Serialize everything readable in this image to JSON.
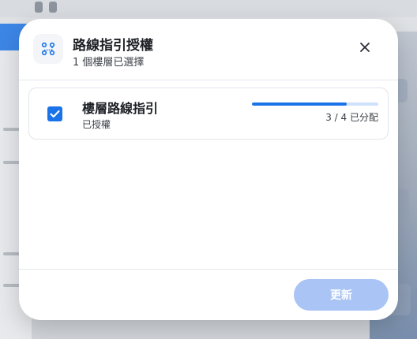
{
  "modal": {
    "title": "路線指引授權",
    "subtitle": "1 個樓層已選擇",
    "icon": "route-icon",
    "close_icon": "close-icon"
  },
  "floor_item": {
    "checked": true,
    "name": "樓層路線指引",
    "status": "已授權",
    "progress_fraction": 0.75,
    "progress_text": "3 / 4 已分配"
  },
  "footer": {
    "update_label": "更新",
    "update_enabled": false
  },
  "colors": {
    "accent": "#1a73e8",
    "accent_light": "#cfe1fb",
    "button_disabled": "#a9c4f5"
  }
}
